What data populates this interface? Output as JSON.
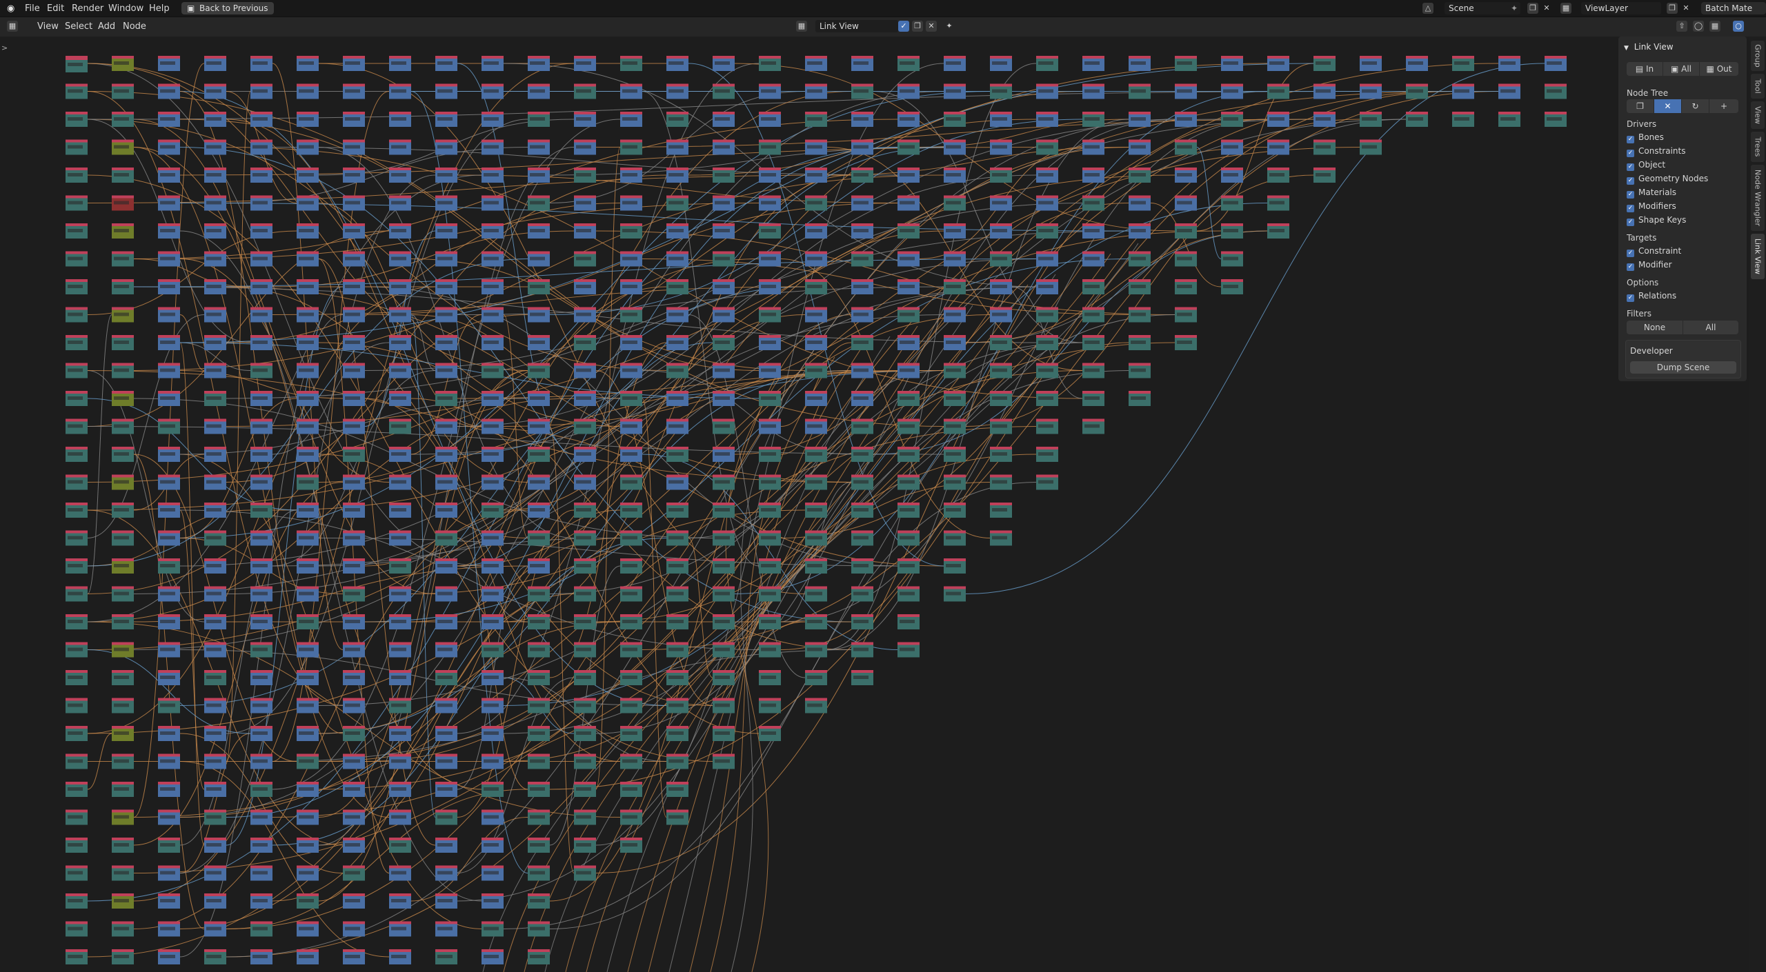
{
  "topbar": {
    "menus": [
      "File",
      "Edit",
      "Render",
      "Window",
      "Help"
    ],
    "back_button": "Back to Previous",
    "scene": "Scene",
    "view_layer": "ViewLayer",
    "workspace": "Batch Mate"
  },
  "editor_header": {
    "menus": [
      "View",
      "Select",
      "Add",
      "Node"
    ],
    "node_tree_name": "Link View"
  },
  "sidebar": {
    "panel_title": "Link View",
    "direction": [
      "In",
      "All",
      "Out"
    ],
    "direction_selected": "All",
    "node_tree_label": "Node Tree",
    "drivers_label": "Drivers",
    "drivers": [
      "Bones",
      "Constraints",
      "Object",
      "Geometry Nodes",
      "Materials",
      "Modifiers",
      "Shape Keys"
    ],
    "targets_label": "Targets",
    "targets": [
      "Constraint",
      "Modifier"
    ],
    "options_label": "Options",
    "options": [
      "Relations"
    ],
    "filters_label": "Filters",
    "filters": [
      "None",
      "All"
    ],
    "developer_label": "Developer",
    "dump_button": "Dump Scene",
    "tabs": [
      "Group",
      "Tool",
      "View",
      "Trees",
      "Node Wrangler",
      "Link View"
    ],
    "active_tab": "Link View"
  },
  "colors": {
    "background": "#1d1d1d",
    "node_header_red": "#c0405a",
    "node_blue": "#4a6fa5",
    "node_teal": "#3b6f6a",
    "node_olive": "#6f7d2a",
    "node_darkred": "#8c3030",
    "link_orange": "#c98a4b",
    "link_blue": "#6aa0d0",
    "link_gray": "#8a8a8a",
    "accent": "#4772b3"
  },
  "icons": {
    "blender_logo": "blender-icon",
    "editor_type": "node-editor-icon",
    "pin": "pin-icon"
  }
}
